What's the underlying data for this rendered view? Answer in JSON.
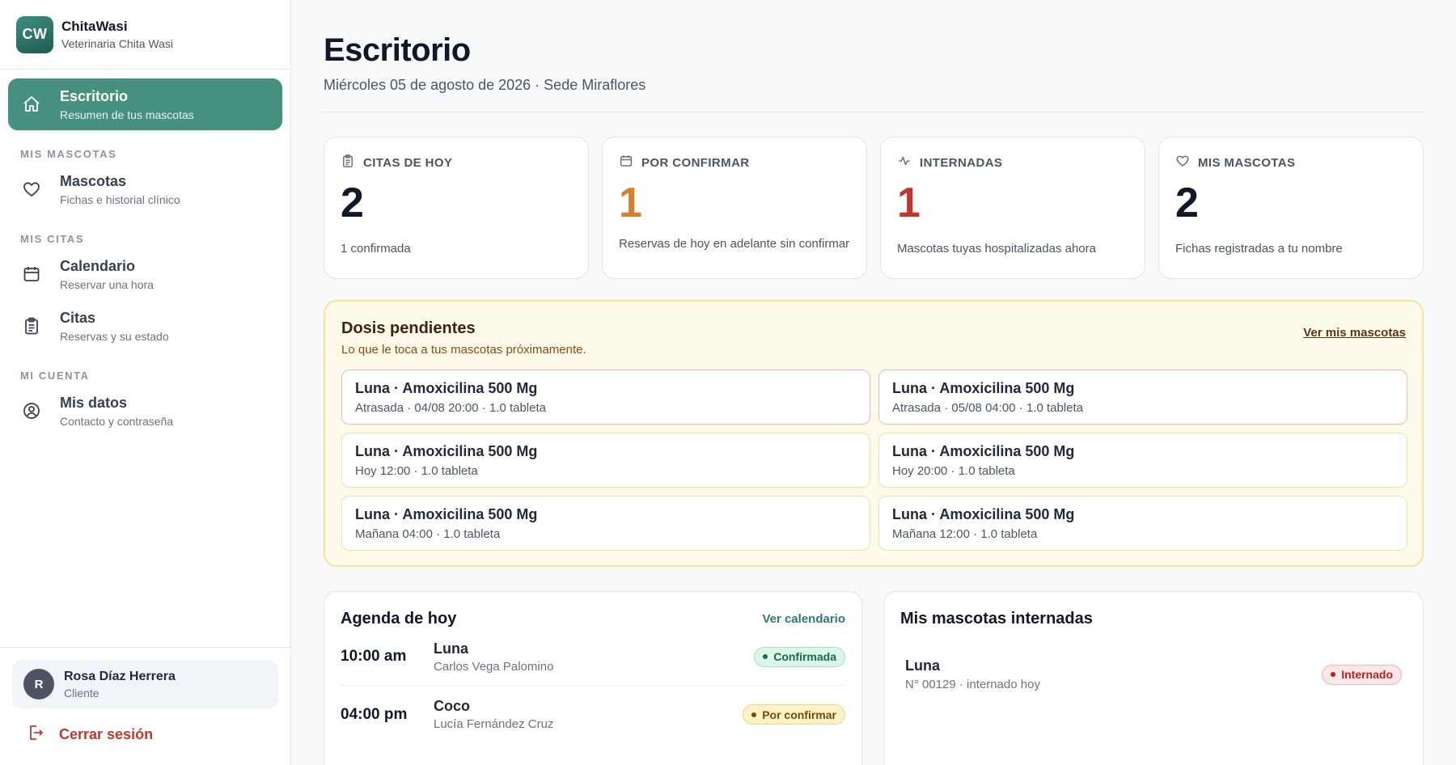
{
  "brand": {
    "logo": "CW",
    "name": "ChitaWasi",
    "subtitle": "Veterinaria Chita Wasi"
  },
  "sidebar": {
    "active": {
      "label": "Escritorio",
      "sub": "Resumen de tus mascotas",
      "icon": "home-icon"
    },
    "sections": [
      {
        "title": "MIS MASCOTAS",
        "items": [
          {
            "label": "Mascotas",
            "sub": "Fichas e historial clínico",
            "icon": "heart-icon"
          }
        ]
      },
      {
        "title": "MIS CITAS",
        "items": [
          {
            "label": "Calendario",
            "sub": "Reservar una hora",
            "icon": "calendar-icon"
          },
          {
            "label": "Citas",
            "sub": "Reservas y su estado",
            "icon": "clipboard-icon"
          }
        ]
      },
      {
        "title": "MI CUENTA",
        "items": [
          {
            "label": "Mis datos",
            "sub": "Contacto y contraseña",
            "icon": "user-circle-icon"
          }
        ]
      }
    ],
    "user": {
      "initial": "R",
      "name": "Rosa Díaz Herrera",
      "role": "Cliente"
    },
    "logout_label": "Cerrar sesión"
  },
  "header": {
    "title": "Escritorio",
    "subtitle": "Miércoles 05 de agosto de 2026 · Sede Miraflores"
  },
  "stats": [
    {
      "label": "CITAS DE HOY",
      "value": "2",
      "desc": "1 confirmada",
      "color": "#111827",
      "icon": "clipboard-icon"
    },
    {
      "label": "POR CONFIRMAR",
      "value": "1",
      "desc": "Reservas de hoy en adelante sin confirmar",
      "color": "#d4822a",
      "icon": "calendar-icon"
    },
    {
      "label": "INTERNADAS",
      "value": "1",
      "desc": "Mascotas tuyas hospitalizadas ahora",
      "color": "#c2372d",
      "icon": "activity-icon"
    },
    {
      "label": "MIS MASCOTAS",
      "value": "2",
      "desc": "Fichas registradas a tu nombre",
      "color": "#111827",
      "icon": "heart-icon"
    }
  ],
  "doses": {
    "title": "Dosis pendientes",
    "subtitle": "Lo que le toca a tus mascotas próximamente.",
    "link": "Ver mis mascotas",
    "items": [
      {
        "name": "Luna · Amoxicilina 500 Mg",
        "detail": "Atrasada · 04/08 20:00 · 1.0 tableta",
        "late": true
      },
      {
        "name": "Luna · Amoxicilina 500 Mg",
        "detail": "Atrasada · 05/08 04:00 · 1.0 tableta",
        "late": true
      },
      {
        "name": "Luna · Amoxicilina 500 Mg",
        "detail": "Hoy 12:00 · 1.0 tableta",
        "late": false
      },
      {
        "name": "Luna · Amoxicilina 500 Mg",
        "detail": "Hoy 20:00 · 1.0 tableta",
        "late": false
      },
      {
        "name": "Luna · Amoxicilina 500 Mg",
        "detail": "Mañana 04:00 · 1.0 tableta",
        "late": false
      },
      {
        "name": "Luna · Amoxicilina 500 Mg",
        "detail": "Mañana 12:00 · 1.0 tableta",
        "late": false
      }
    ]
  },
  "agenda": {
    "title": "Agenda de hoy",
    "link": "Ver calendario",
    "items": [
      {
        "time": "10:00 am",
        "pet": "Luna",
        "owner": "Carlos Vega Palomino",
        "status": "Confirmada"
      },
      {
        "time": "04:00 pm",
        "pet": "Coco",
        "owner": "Lucía Fernández Cruz",
        "status": "Por confirmar"
      }
    ]
  },
  "hospitalized": {
    "title": "Mis mascotas internadas",
    "items": [
      {
        "pet": "Luna",
        "detail": "N° 00129 · internado hoy",
        "status": "Internado"
      }
    ]
  }
}
